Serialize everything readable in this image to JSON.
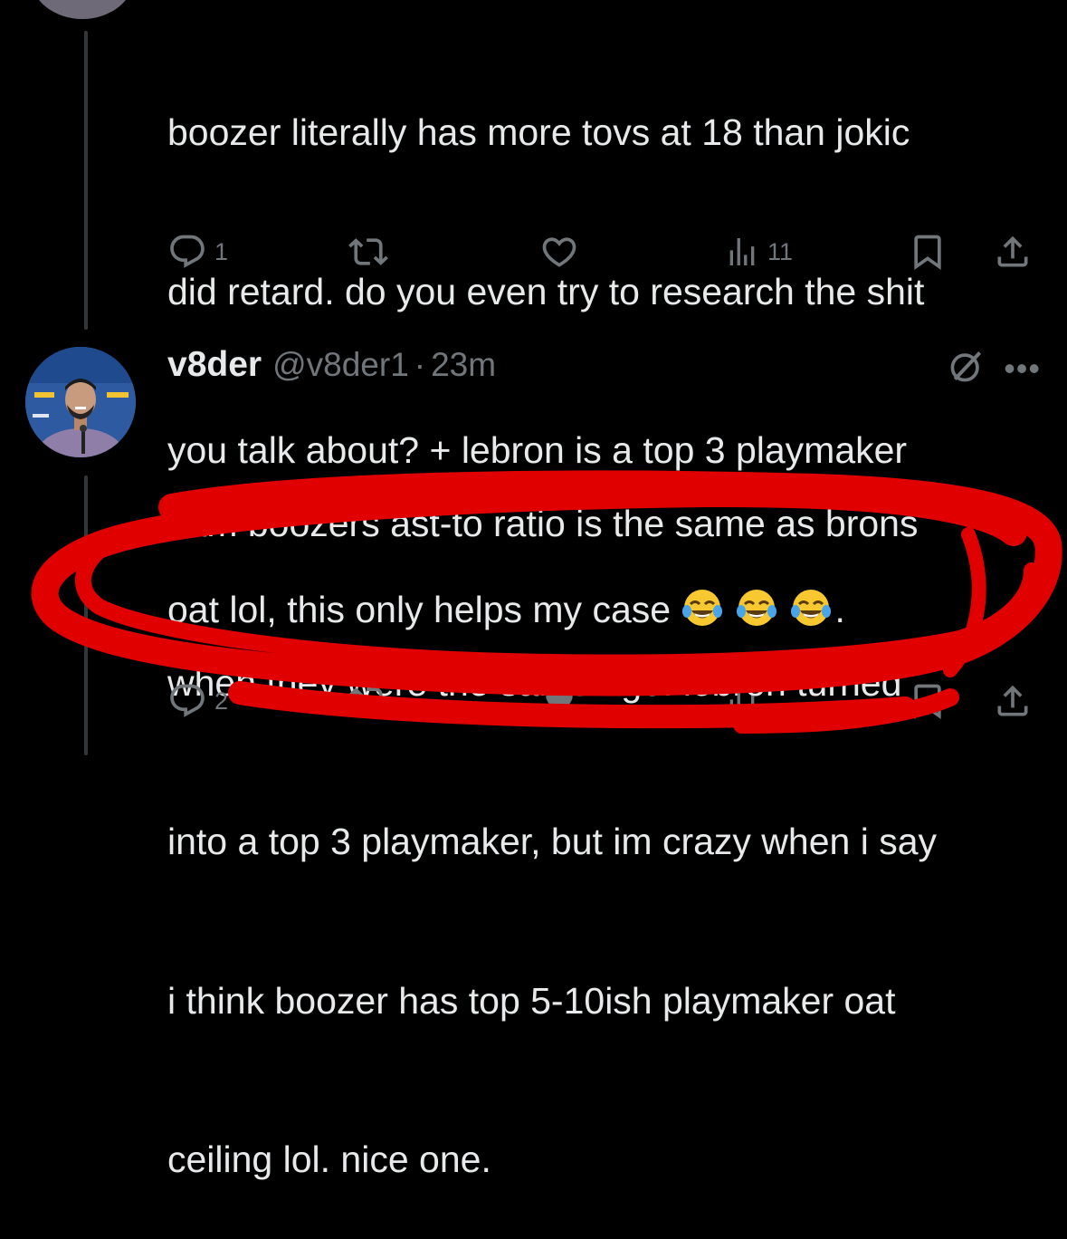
{
  "tweet1": {
    "lines": [
      "boozer literally has more tovs at 18 than jokic",
      "did retard. do you even try to research the shit",
      "you talk about? + lebron is a top 3 playmaker",
      "oat lol, this only helps my case"
    ],
    "trailing_punct": ".",
    "emoji_names": [
      "face-with-tears-of-joy",
      "face-with-tears-of-joy",
      "face-with-tears-of-joy"
    ],
    "actions": {
      "replies": "1",
      "retweets": "",
      "likes": "",
      "views": "11"
    }
  },
  "tweet2": {
    "display_name": "v8der",
    "handle": "@v8der1",
    "separator": "·",
    "time": "23m",
    "lines": [
      "cam boozers ast-to ratio is the same as brons",
      "when they were the same age. lebron turned",
      "into a top 3 playmaker, but im crazy when i say",
      "i think boozer has top 5-10ish playmaker oat",
      "ceiling lol. nice one."
    ],
    "actions": {
      "replies": "2"
    }
  },
  "icons": {
    "reply": "reply-icon",
    "retweet": "retweet-icon",
    "like": "heart-icon",
    "views": "views-icon",
    "bookmark": "bookmark-icon",
    "share": "share-icon",
    "grok": "grok-icon",
    "more": "more-icon"
  },
  "colors": {
    "background": "#000000",
    "text": "#e7e9ea",
    "muted": "#71767b",
    "annotation": "#e00000"
  }
}
